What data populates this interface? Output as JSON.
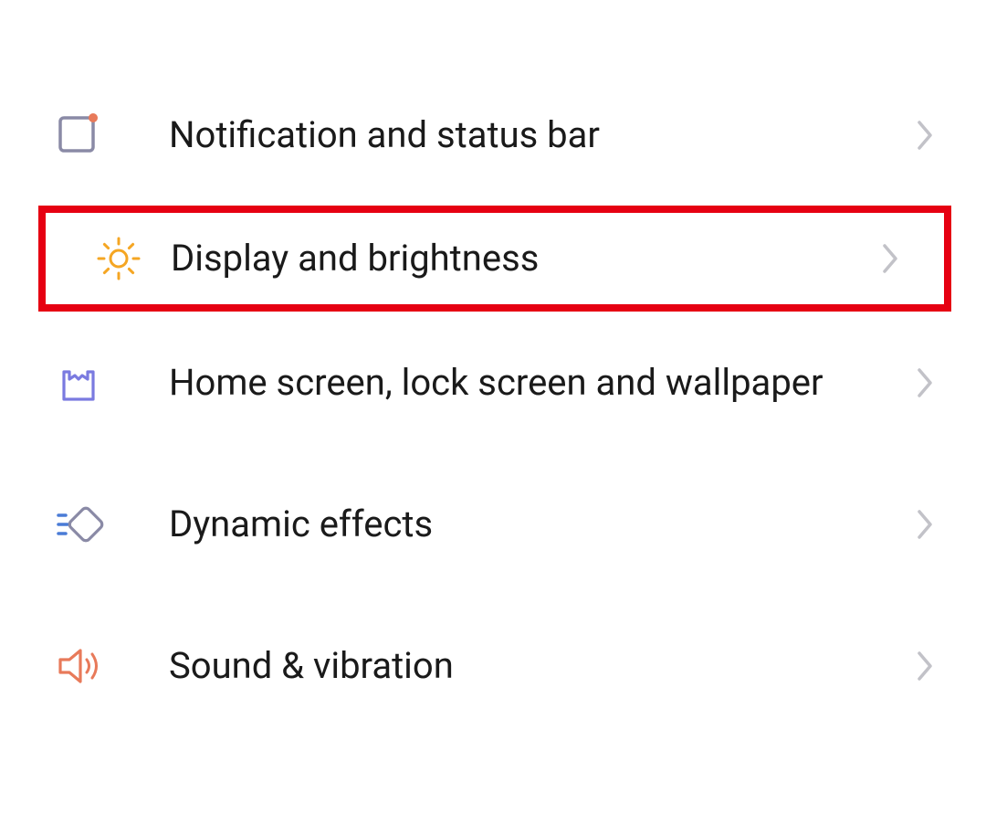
{
  "settings": {
    "items": [
      {
        "label": "Notification and status bar"
      },
      {
        "label": "Display and brightness"
      },
      {
        "label": "Home screen, lock screen and wallpaper"
      },
      {
        "label": "Dynamic effects"
      },
      {
        "label": "Sound & vibration"
      }
    ],
    "highlighted_index": 1
  }
}
